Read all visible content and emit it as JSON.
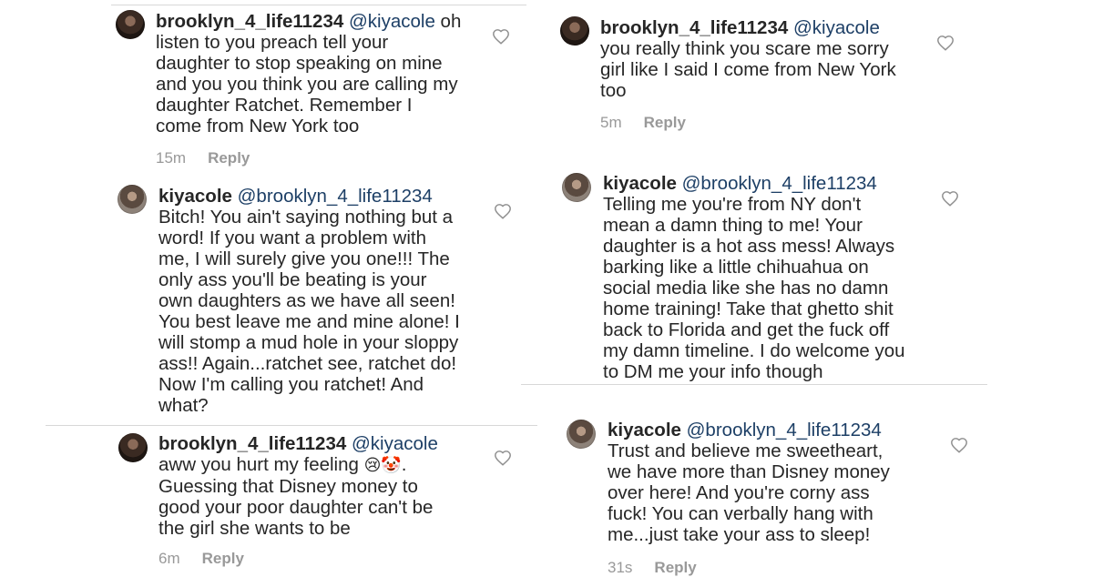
{
  "comments": [
    {
      "user": "brooklyn_4_life11234",
      "mention": "@kiyacole",
      "body": "oh\nlisten to you preach tell your\ndaughter to stop speaking on mine\nand you you think you are calling my\ndaughter Ratchet.  Remember I\ncome from New York too",
      "time": "15m",
      "reply": "Reply"
    },
    {
      "user": "kiyacole",
      "mention": "@brooklyn_4_life11234",
      "body": "Bitch! You ain't saying nothing but a\nword! If you want a problem with\nme, I will surely give you one!!! The\nonly ass you'll be beating is your\nown daughters as we have all seen!\nYou best leave me and mine alone! I\nwill stomp a mud hole in your sloppy\nass!! Again...ratchet see, ratchet do!\nNow I'm calling you ratchet! And\nwhat?",
      "time": "",
      "reply": ""
    },
    {
      "user": "brooklyn_4_life11234",
      "mention": "@kiyacole",
      "body_before_emoji": "aww you hurt my feeling",
      "emoji": "😢🤡",
      "body_after_emoji": ".\nGuessing that Disney money to\ngood your poor daughter can't be\nthe girl she wants to be",
      "time": "6m",
      "reply": "Reply"
    },
    {
      "user": "brooklyn_4_life11234",
      "mention": "@kiyacole",
      "body": "you really think you scare me sorry\ngirl like I said I come from New York\ntoo",
      "time": "5m",
      "reply": "Reply"
    },
    {
      "user": "kiyacole",
      "mention": "@brooklyn_4_life11234",
      "body": "Telling me you're from NY don't\nmean a damn thing to me! Your\ndaughter is a hot ass mess! Always\nbarking like a little chihuahua on\nsocial media like she has no damn\nhome training! Take that ghetto shit\nback to Florida and get the fuck off\nmy damn timeline. I do welcome you\nto DM me your info though",
      "time": "",
      "reply": ""
    },
    {
      "user": "kiyacole",
      "mention": "@brooklyn_4_life11234",
      "body": "Trust and believe me sweetheart,\nwe have more than Disney money\nover here! And you're corny ass\nfuck! You can verbally hang with\nme...just take your ass to sleep!",
      "time": "31s",
      "reply": "Reply"
    }
  ]
}
